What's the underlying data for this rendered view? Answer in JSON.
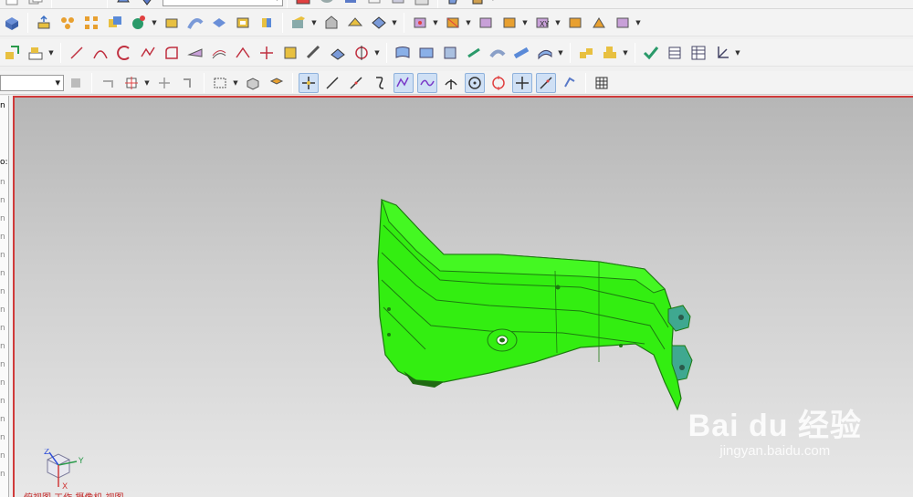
{
  "toolbar": {
    "row0_combo_value": "",
    "row3_filter_combo_value": ""
  },
  "colors": {
    "part_fill": "#33ee11",
    "part_edge": "#1d7a10",
    "viewport_border": "#d03a3a",
    "selection_highlight": "#cfe0f5"
  },
  "left_panel": {
    "tab_labels": [
      "n",
      "o:",
      "n",
      "n",
      "n",
      "n",
      "n",
      "n",
      "n",
      "n",
      "n",
      "n",
      "n",
      "n",
      "n",
      "n",
      "n",
      "n",
      "n"
    ]
  },
  "viewport": {
    "triad_axes": {
      "z": "Z",
      "y": "Y",
      "x": "X"
    },
    "status_text": "俯视图 工作 摄像机 视图",
    "watermark": {
      "logo": "Bai du 经验",
      "url": "jingyan.baidu.com"
    }
  },
  "icons": {
    "row1": [
      "solid-box-icon",
      "extrude-icon",
      "pattern-icon",
      "array-icon",
      "boolean-icon",
      "sphere-icon",
      "block-icon",
      "sweep-icon",
      "surface-icon",
      "shell-icon",
      "cylinder-icon",
      "blend-icon",
      "chamfer-icon",
      "cone-icon",
      "trim-body-icon",
      "offset-face-icon",
      "split-face-icon",
      "replace-face-icon",
      "move-face-icon",
      "delete-face-icon",
      "copy-face-icon",
      "mirror-face-icon",
      "resize-face-icon"
    ],
    "row2": [
      "assembly-icon",
      "measure-icon",
      "line-icon",
      "arc-icon",
      "spline-icon",
      "point-icon",
      "fillet-sketch-icon",
      "project-curve-icon",
      "offset-curve-icon",
      "bridge-curve-icon",
      "join-curve-icon",
      "split-curve-icon",
      "intersect-curve-icon",
      "mesh-surface-icon",
      "through-curves-icon",
      "ruled-surface-icon",
      "n-sided-icon",
      "swoop-icon",
      "law-extension-icon",
      "studio-surface-icon",
      "styled-blend-icon",
      "component-icon",
      "add-component-icon",
      "check-icon",
      "table-icon",
      "spreadsheet-icon",
      "datum-csys-icon"
    ],
    "row3": [
      "select-part-icon",
      "undo-icon",
      "snap-point-icon",
      "move-icon",
      "rectangle-select-icon",
      "cube-select-icon",
      "face-select-icon",
      "snap-end-icon",
      "snap-mid-icon",
      "snap-control-icon",
      "snap-arc-icon",
      "snap-curve-icon",
      "snap-intersect-icon",
      "snap-center-icon",
      "snap-quadrant-icon",
      "snap-plus-icon",
      "snap-line-icon",
      "snap-face-icon",
      "grid-icon"
    ]
  }
}
